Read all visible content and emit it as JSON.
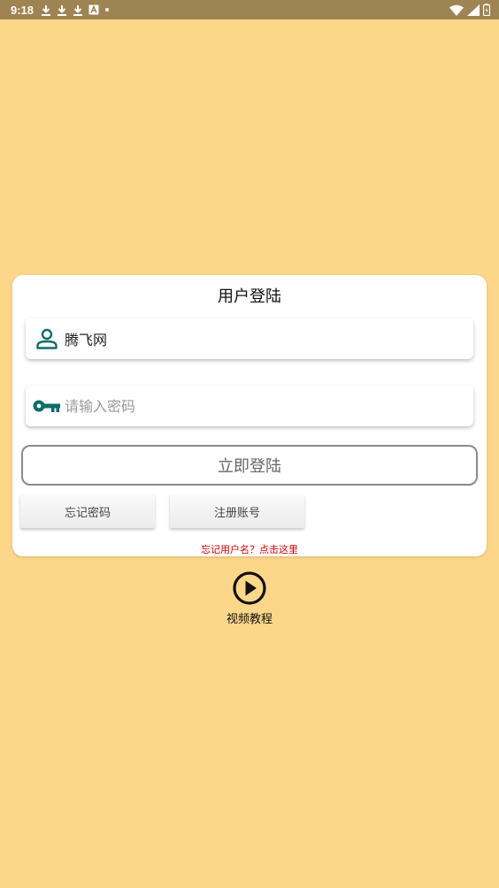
{
  "status_bar": {
    "time": "9:18",
    "left_icons": [
      "download-icon",
      "download-icon",
      "download-icon",
      "font-icon",
      "dot-icon"
    ],
    "right_icons": [
      "wifi-icon",
      "signal-icon",
      "battery-icon"
    ]
  },
  "login": {
    "title": "用户登陆",
    "username_value": "腾飞网",
    "password_placeholder": "请输入密码",
    "login_button": "立即登陆",
    "forgot_password": "忘记密码",
    "register": "注册账号",
    "forgot_username": "忘记用户名？点击这里"
  },
  "tutorial": {
    "label": "视频教程"
  },
  "colors": {
    "background": "#FCD789",
    "status_bar": "#9E8452",
    "icon_teal": "#0E6E66",
    "link_red": "#D50000"
  }
}
